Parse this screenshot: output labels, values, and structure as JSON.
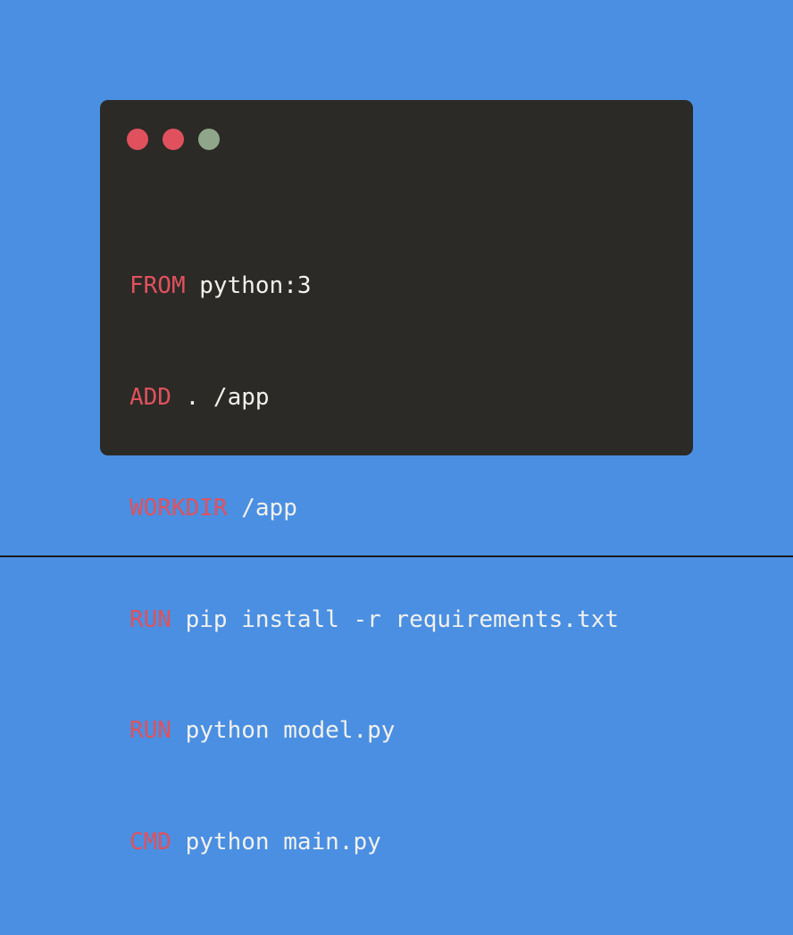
{
  "colors": {
    "background": "#4a8fe2",
    "window": "#2b2a26",
    "keyword": "#e0515d",
    "text": "#f2f1ec",
    "dot_red": "#e0515d",
    "dot_red2": "#e0515d",
    "dot_green": "#8fa68a"
  },
  "window": {
    "controls": [
      {
        "name": "close",
        "color": "#e0515d"
      },
      {
        "name": "minimize",
        "color": "#e0515d"
      },
      {
        "name": "maximize",
        "color": "#8fa68a"
      }
    ]
  },
  "code": {
    "language": "Dockerfile",
    "lines": [
      {
        "keyword": "FROM",
        "args": "python:3"
      },
      {
        "keyword": "ADD",
        "args": ". /app"
      },
      {
        "keyword": "WORKDIR",
        "args": "/app"
      },
      {
        "keyword": "RUN",
        "args": "pip install -r requirements.txt"
      },
      {
        "keyword": "RUN",
        "args": "python model.py"
      },
      {
        "keyword": "CMD",
        "args": "python main.py"
      }
    ]
  }
}
